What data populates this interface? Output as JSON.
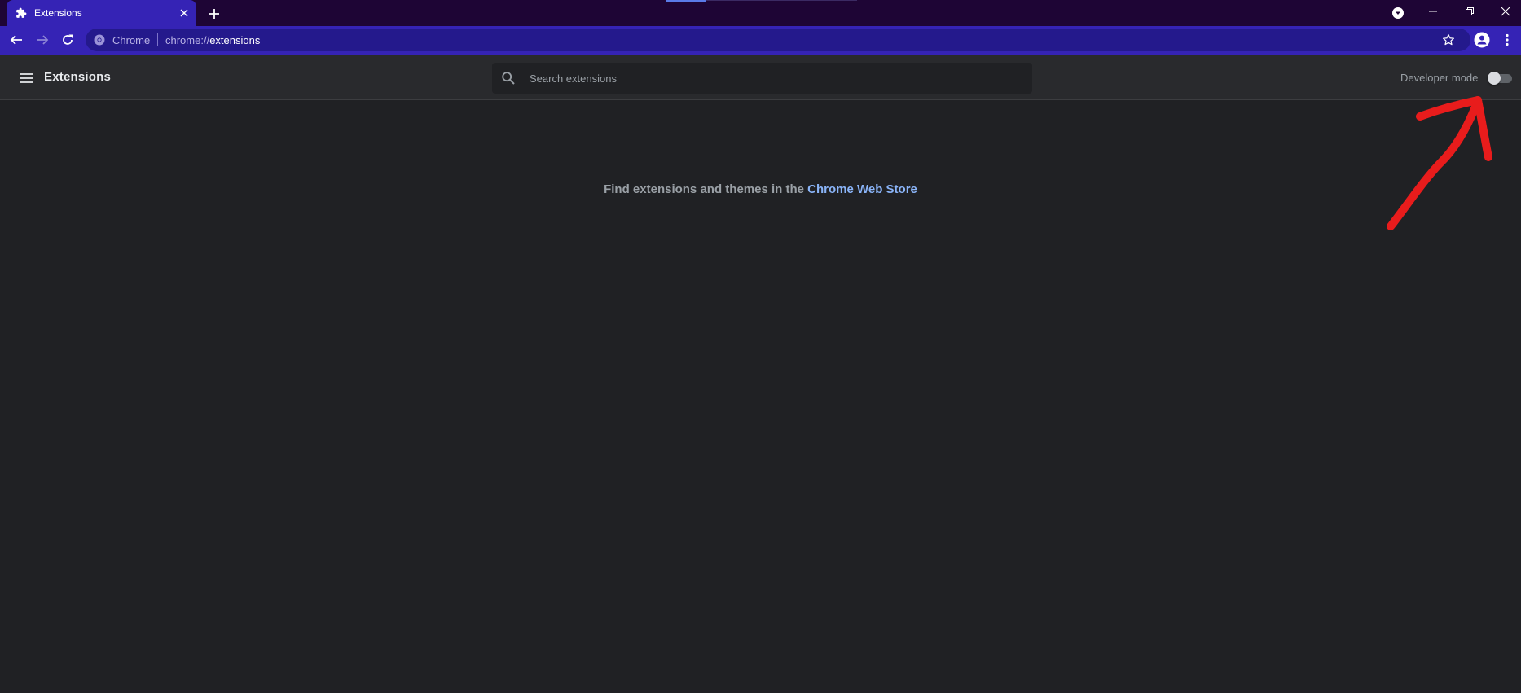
{
  "browser": {
    "tab": {
      "title": "Extensions",
      "icon": "puzzle-icon"
    },
    "new_tab_icon": "plus-icon",
    "window_controls": [
      "profile-dropdown-icon",
      "minimize-icon",
      "restore-icon",
      "close-icon"
    ],
    "omnibox": {
      "site_chip": "Chrome",
      "url_scheme": "chrome://",
      "url_host": "extensions"
    },
    "colors": {
      "tab_strip": "#1e0535",
      "toolbar": "#3523b5",
      "omnibox": "#24198c"
    }
  },
  "extensions_page": {
    "title": "Extensions",
    "search": {
      "placeholder": "Search extensions",
      "value": ""
    },
    "developer_mode": {
      "label": "Developer mode",
      "enabled": false
    },
    "empty_state": {
      "prefix": "Find extensions and themes in the ",
      "link_text": "Chrome Web Store"
    },
    "colors": {
      "background": "#202124",
      "header": "#292a2d",
      "link": "#8ab4f8",
      "annotation_arrow": "#e81c1c"
    }
  }
}
